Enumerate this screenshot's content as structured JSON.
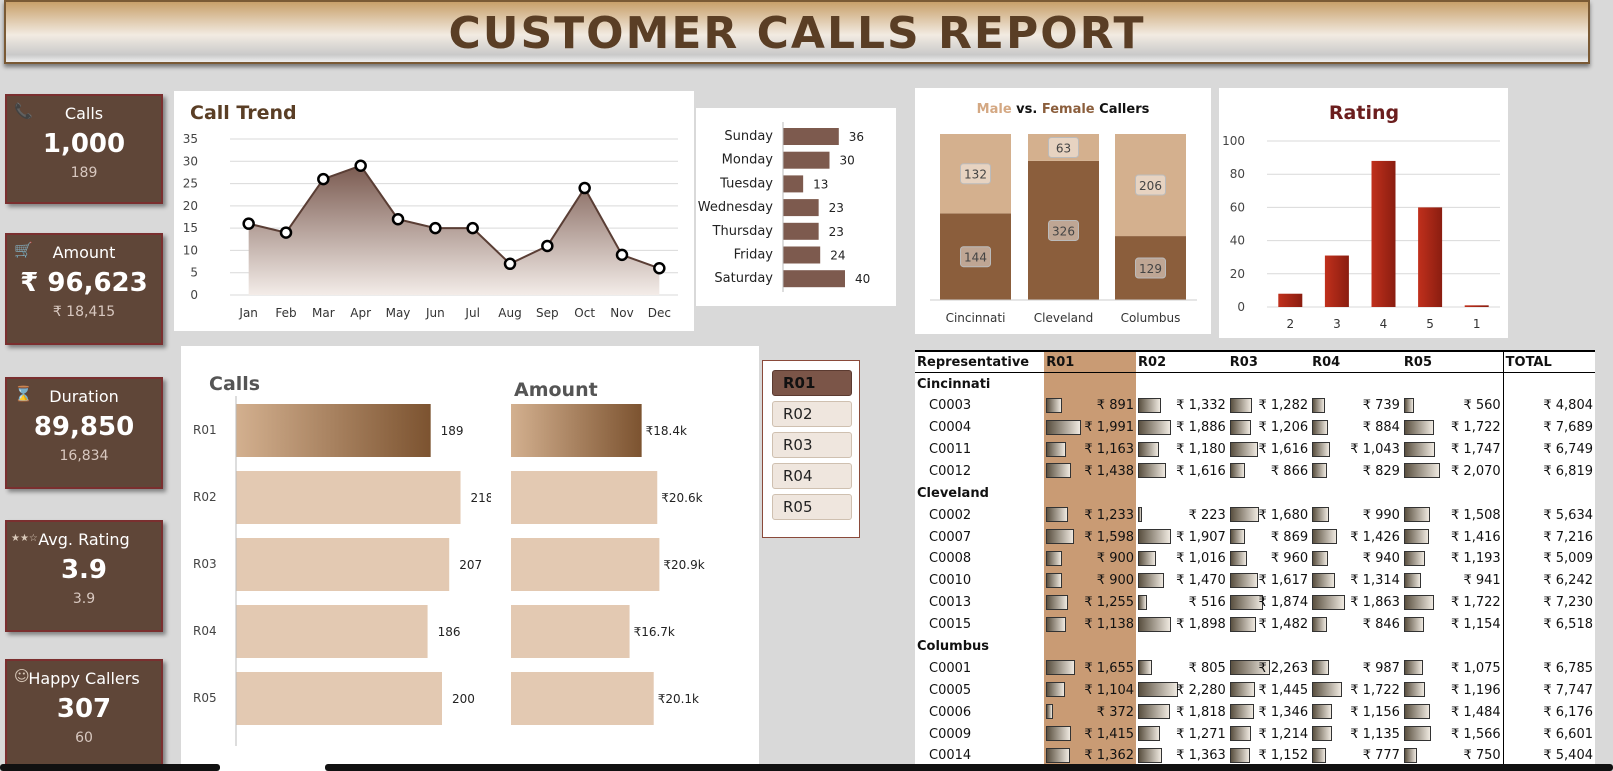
{
  "header": {
    "title": "CUSTOMER CALLS REPORT"
  },
  "kpis": [
    {
      "icon": "phone-icon",
      "glyph": "📞",
      "title": "Calls",
      "value": "1,000",
      "sub": "189"
    },
    {
      "icon": "cart-icon",
      "glyph": "🛒",
      "title": "Amount",
      "value": "₹ 96,623",
      "sub": "₹ 18,415"
    },
    {
      "icon": "hourglass-icon",
      "glyph": "⌛",
      "title": "Duration",
      "value": "89,850",
      "sub": "16,834"
    },
    {
      "icon": "stars-icon",
      "glyph": "★★☆",
      "title": "Avg. Rating",
      "value": "3.9",
      "sub": "3.9"
    },
    {
      "icon": "smiley-icon",
      "glyph": "☺",
      "title": "Happy Callers",
      "value": "307",
      "sub": "60"
    }
  ],
  "chart_data": [
    {
      "type": "area",
      "title": "Call Trend",
      "categories": [
        "Jan",
        "Feb",
        "Mar",
        "Apr",
        "May",
        "Jun",
        "Jul",
        "Aug",
        "Sep",
        "Oct",
        "Nov",
        "Dec"
      ],
      "values": [
        16,
        14,
        26,
        29,
        17,
        15,
        15,
        7,
        11,
        24,
        9,
        6
      ],
      "ylim": [
        0,
        35
      ],
      "yticks": [
        0,
        5,
        10,
        15,
        20,
        25,
        30,
        35
      ],
      "grid": true
    },
    {
      "type": "bar",
      "orientation": "horizontal",
      "categories": [
        "Sunday",
        "Monday",
        "Tuesday",
        "Wednesday",
        "Thursday",
        "Friday",
        "Saturday"
      ],
      "values": [
        36,
        30,
        13,
        23,
        23,
        24,
        40
      ]
    },
    {
      "type": "bar",
      "stacked": true,
      "title": {
        "male": "Male",
        "vs": "vs.",
        "female": "Female",
        "rest": "Callers"
      },
      "categories": [
        "Cincinnati",
        "Cleveland",
        "Columbus"
      ],
      "series": [
        {
          "name": "Male",
          "values": [
            144,
            326,
            129
          ],
          "color": "#8b5e3c"
        },
        {
          "name": "Female",
          "values": [
            132,
            63,
            206
          ],
          "color": "#d4b08e"
        }
      ]
    },
    {
      "type": "bar",
      "title": "Rating",
      "categories": [
        "2",
        "3",
        "4",
        "5",
        "1"
      ],
      "values": [
        8,
        31,
        88,
        60,
        1
      ],
      "ylim": [
        0,
        100
      ],
      "yticks": [
        0,
        20,
        40,
        60,
        80,
        100
      ],
      "grid": true
    },
    {
      "type": "bar",
      "orientation": "horizontal",
      "title": "Calls",
      "categories": [
        "R01",
        "R02",
        "R03",
        "R04",
        "R05"
      ],
      "values": [
        189,
        218,
        207,
        186,
        200
      ],
      "labels": [
        "189",
        "218",
        "207",
        "186",
        "200"
      ]
    },
    {
      "type": "bar",
      "orientation": "horizontal",
      "title": "Amount",
      "categories": [
        "R01",
        "R02",
        "R03",
        "R04",
        "R05"
      ],
      "values": [
        18.4,
        20.6,
        20.9,
        16.7,
        20.1
      ],
      "labels": [
        "₹18.4k",
        "₹20.6k",
        "₹20.9k",
        "₹16.7k",
        "₹20.1k"
      ]
    }
  ],
  "slicer": {
    "items": [
      "R01",
      "R02",
      "R03",
      "R04",
      "R05"
    ],
    "selected": "R01"
  },
  "table": {
    "headers": [
      "Representative",
      "R01",
      "R02",
      "R03",
      "R04",
      "R05",
      "TOTAL"
    ],
    "groups": [
      {
        "name": "Cincinnati",
        "rows": [
          {
            "id": "C0003",
            "vals": [
              891,
              1332,
              1282,
              739,
              560
            ],
            "disp": [
              "₹ 891",
              "₹ 1,332",
              "₹ 1,282",
              "₹ 739",
              "₹ 560"
            ],
            "total": "₹ 4,804"
          },
          {
            "id": "C0004",
            "vals": [
              1991,
              1886,
              1206,
              884,
              1722
            ],
            "disp": [
              "₹ 1,991",
              "₹ 1,886",
              "₹ 1,206",
              "₹ 884",
              "₹ 1,722"
            ],
            "total": "₹ 7,689"
          },
          {
            "id": "C0011",
            "vals": [
              1163,
              1180,
              1616,
              1043,
              1747
            ],
            "disp": [
              "₹ 1,163",
              "₹ 1,180",
              "₹ 1,616",
              "₹ 1,043",
              "₹ 1,747"
            ],
            "total": "₹ 6,749"
          },
          {
            "id": "C0012",
            "vals": [
              1438,
              1616,
              866,
              829,
              2070
            ],
            "disp": [
              "₹ 1,438",
              "₹ 1,616",
              "₹ 866",
              "₹ 829",
              "₹ 2,070"
            ],
            "total": "₹ 6,819"
          }
        ]
      },
      {
        "name": "Cleveland",
        "rows": [
          {
            "id": "C0002",
            "vals": [
              1233,
              223,
              1680,
              990,
              1508
            ],
            "disp": [
              "₹ 1,233",
              "₹ 223",
              "₹ 1,680",
              "₹ 990",
              "₹ 1,508"
            ],
            "total": "₹ 5,634"
          },
          {
            "id": "C0007",
            "vals": [
              1598,
              1907,
              869,
              1426,
              1416
            ],
            "disp": [
              "₹ 1,598",
              "₹ 1,907",
              "₹ 869",
              "₹ 1,426",
              "₹ 1,416"
            ],
            "total": "₹ 7,216"
          },
          {
            "id": "C0008",
            "vals": [
              900,
              1016,
              960,
              940,
              1193
            ],
            "disp": [
              "₹ 900",
              "₹ 1,016",
              "₹ 960",
              "₹ 940",
              "₹ 1,193"
            ],
            "total": "₹ 5,009"
          },
          {
            "id": "C0010",
            "vals": [
              900,
              1470,
              1617,
              1314,
              941
            ],
            "disp": [
              "₹ 900",
              "₹ 1,470",
              "₹ 1,617",
              "₹ 1,314",
              "₹ 941"
            ],
            "total": "₹ 6,242"
          },
          {
            "id": "C0013",
            "vals": [
              1255,
              516,
              1874,
              1863,
              1722
            ],
            "disp": [
              "₹ 1,255",
              "₹ 516",
              "₹ 1,874",
              "₹ 1,863",
              "₹ 1,722"
            ],
            "total": "₹ 7,230"
          },
          {
            "id": "C0015",
            "vals": [
              1138,
              1898,
              1482,
              846,
              1154
            ],
            "disp": [
              "₹ 1,138",
              "₹ 1,898",
              "₹ 1,482",
              "₹ 846",
              "₹ 1,154"
            ],
            "total": "₹ 6,518"
          }
        ]
      },
      {
        "name": "Columbus",
        "rows": [
          {
            "id": "C0001",
            "vals": [
              1655,
              805,
              2263,
              987,
              1075
            ],
            "disp": [
              "₹ 1,655",
              "₹ 805",
              "₹ 2,263",
              "₹ 987",
              "₹ 1,075"
            ],
            "total": "₹ 6,785"
          },
          {
            "id": "C0005",
            "vals": [
              1104,
              2280,
              1445,
              1722,
              1196
            ],
            "disp": [
              "₹ 1,104",
              "₹ 2,280",
              "₹ 1,445",
              "₹ 1,722",
              "₹ 1,196"
            ],
            "total": "₹ 7,747"
          },
          {
            "id": "C0006",
            "vals": [
              372,
              1818,
              1346,
              1156,
              1484
            ],
            "disp": [
              "₹ 372",
              "₹ 1,818",
              "₹ 1,346",
              "₹ 1,156",
              "₹ 1,484"
            ],
            "total": "₹ 6,176"
          },
          {
            "id": "C0009",
            "vals": [
              1415,
              1271,
              1214,
              1135,
              1566
            ],
            "disp": [
              "₹ 1,415",
              "₹ 1,271",
              "₹ 1,214",
              "₹ 1,135",
              "₹ 1,566"
            ],
            "total": "₹ 6,601"
          },
          {
            "id": "C0014",
            "vals": [
              1362,
              1363,
              1152,
              777,
              750
            ],
            "disp": [
              "₹ 1,362",
              "₹ 1,363",
              "₹ 1,152",
              "₹ 777",
              "₹ 750"
            ],
            "total": "₹ 5,404"
          }
        ]
      }
    ]
  }
}
